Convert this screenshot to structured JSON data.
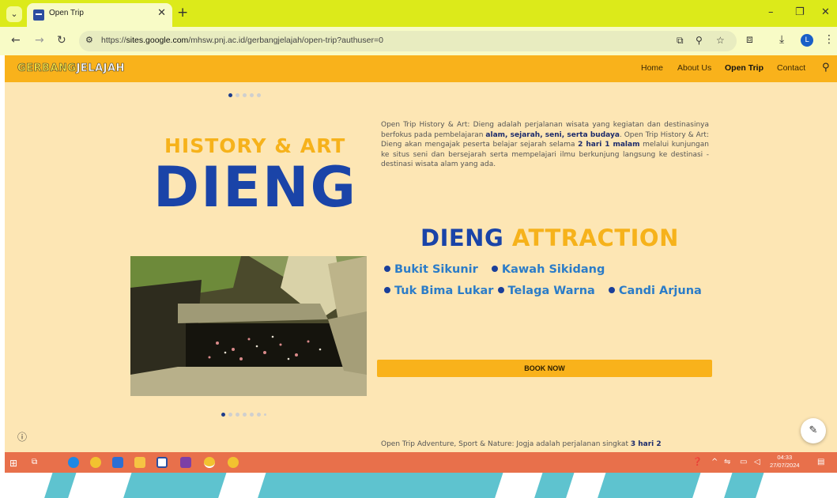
{
  "browser": {
    "tab_title": "Open Trip",
    "new_tab_icon": "plus-icon",
    "url_host": "sites.google.com",
    "url_rest": "/mhsw.pnj.ac.id/gerbangjelajah/open-trip?authuser=0",
    "url_scheme": "https://",
    "profile_initial": "L"
  },
  "site": {
    "logo_part1": "GERBANG",
    "logo_part2": "JELAJAH",
    "nav": [
      "Home",
      "About Us",
      "Open Trip",
      "Contact"
    ],
    "active_nav": "Open Trip"
  },
  "hero": {
    "subtitle": "HISTORY & ART",
    "title": "DIENG"
  },
  "description": {
    "p1": "Open Trip History & Art: Dieng adalah perjalanan wisata yang kegiatan dan destinasinya berfokus pada pembelajaran ",
    "p1_bold": "alam, sejarah, seni, serta budaya",
    "p2": ". Open Trip History & Art: Dieng akan mengajak peserta belajar sejarah selama ",
    "p2_bold": "2 hari 1 malam",
    "p3": " melalui kunjungan ke situs seni dan bersejarah serta mempelajari ilmu berkunjung langsung ke destinasi - destinasi wisata alam yang ada."
  },
  "attraction": {
    "title_word1": "DIENG",
    "title_word2": "ATTRACTION",
    "items": [
      "Bukit Sikunir",
      "Kawah Sikidang",
      "Tuk Bima Lukar",
      "Telaga Warna",
      "Candi Arjuna"
    ]
  },
  "book_now": "BOOK NOW",
  "next_trip": {
    "text": "Open Trip Adventure, Sport & Nature: Jogja adalah perjalanan singkat ",
    "bold": "3 hari 2"
  },
  "taskbar": {
    "time": "04:33",
    "date": "27/07/2024"
  },
  "colors": {
    "tab_strip": "#dcea1a",
    "header": "#f9b21b",
    "page_bg": "#fde6b4",
    "primary_blue": "#1a44a8",
    "taskbar": "#e8704b"
  }
}
